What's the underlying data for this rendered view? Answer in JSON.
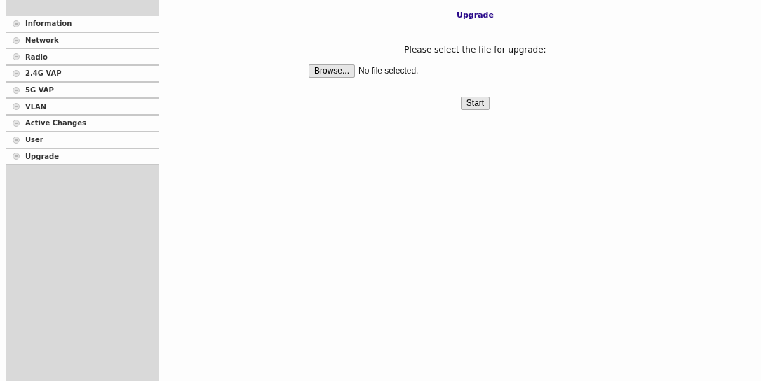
{
  "sidebar": {
    "items": [
      {
        "label": "Information"
      },
      {
        "label": "Network"
      },
      {
        "label": "Radio"
      },
      {
        "label": "2.4G VAP"
      },
      {
        "label": "5G VAP"
      },
      {
        "label": "VLAN"
      },
      {
        "label": "Active Changes"
      },
      {
        "label": "User"
      },
      {
        "label": "Upgrade"
      }
    ]
  },
  "page": {
    "title": "Upgrade",
    "prompt": "Please select the file for upgrade:",
    "browse_button": "Browse...",
    "file_status": "No file selected.",
    "start_button": "Start"
  }
}
